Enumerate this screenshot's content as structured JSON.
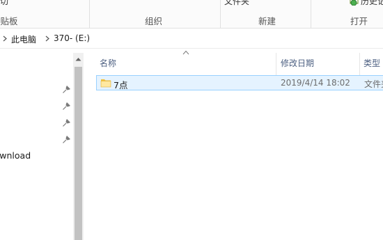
{
  "ribbon": {
    "clipboard": {
      "cut_label": "剪切",
      "group_label": "剪贴板"
    },
    "organize": {
      "group_label": "组织"
    },
    "new": {
      "new_folder_label": "文件夹",
      "group_label": "新建"
    },
    "open": {
      "history_label": "历史记",
      "group_label": "打开"
    }
  },
  "address_bar": {
    "breadcrumb": [
      "此电脑",
      "370- (E:)"
    ],
    "separator_icon": "chevron-right-icon"
  },
  "nav_pane": {
    "pin_icon": "pin-icon",
    "pinned_count_visible": 4,
    "item_label": "Download"
  },
  "columns": {
    "name": "名称",
    "modified": "修改日期",
    "type": "类型",
    "sorted_by": "name"
  },
  "files": [
    {
      "name": "7点",
      "modified": "2019/4/14 18:02",
      "type": "文件夹",
      "icon": "folder-icon",
      "selected": true
    }
  ],
  "colors": {
    "selection_bg": "#e5f3ff",
    "selection_border": "#99d1ff",
    "header_text": "#4d6082",
    "folder_fill": "#ffe8a0"
  }
}
